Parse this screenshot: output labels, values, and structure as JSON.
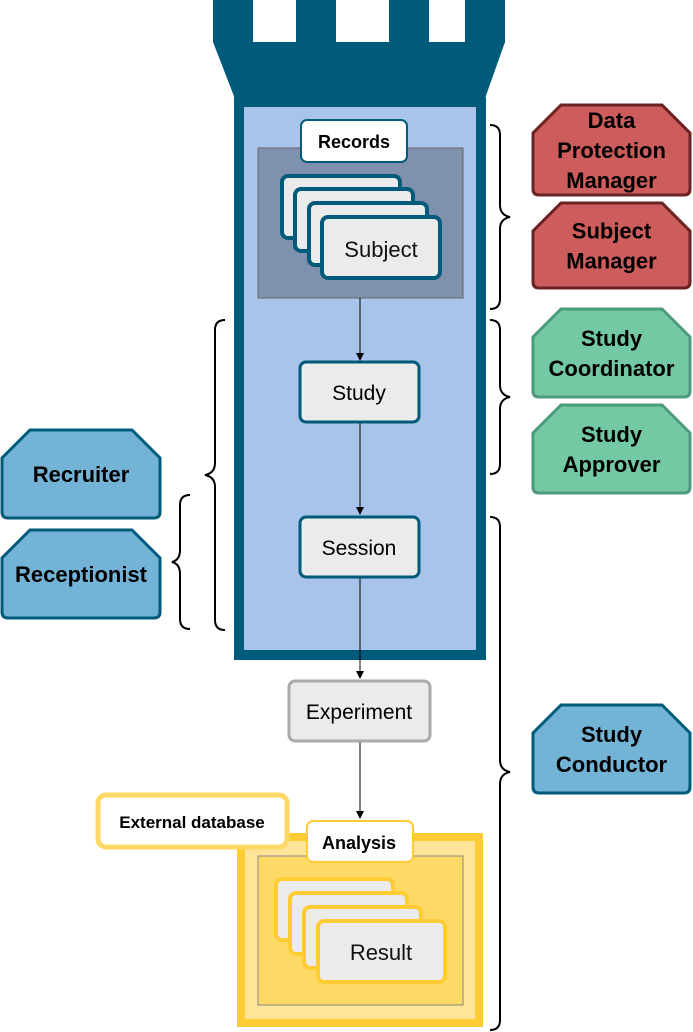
{
  "colors": {
    "tower": "#005b7a",
    "tower_fill": "#a9c4ea",
    "records_fill": "#7f91ad",
    "red_role": "#cd5c5c",
    "green_role": "#72c9a3",
    "blue_role": "#72b3d6",
    "yellow": "#ffcc33"
  },
  "nodes": {
    "records": "Records",
    "subject": "Subject",
    "study": "Study",
    "session": "Session",
    "experiment": "Experiment",
    "analysis": "Analysis",
    "external_database": "External database",
    "result": "Result"
  },
  "roles": {
    "dpm": [
      "Data",
      "Protection",
      "Manager"
    ],
    "subject_manager": [
      "Subject",
      "Manager"
    ],
    "study_coordinator": [
      "Study",
      "Coordinator"
    ],
    "study_approver": [
      "Study",
      "Approver"
    ],
    "recruiter": [
      "Recruiter"
    ],
    "receptionist": [
      "Receptionist"
    ],
    "study_conductor": [
      "Study",
      "Conductor"
    ]
  }
}
